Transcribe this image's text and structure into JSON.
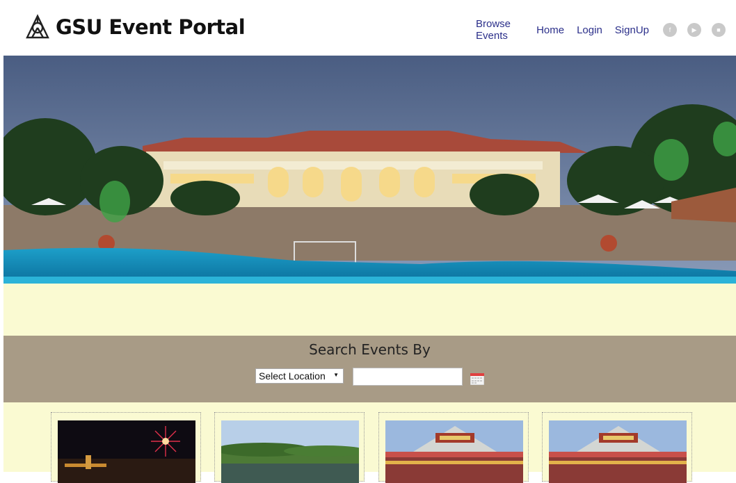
{
  "header": {
    "title": "GSU Event Portal",
    "nav": [
      "Browse Events",
      "Home",
      "Login",
      "SignUp"
    ],
    "social_icons": [
      "facebook-icon",
      "twitter-icon",
      "youtube-icon"
    ]
  },
  "search": {
    "title": "Search Events By",
    "location_value": "Select Location",
    "date_value": ""
  },
  "event_images": [
    "fireworks-night",
    "lake-trees",
    "tandoor-restaurant",
    "tandoor-restaurant"
  ],
  "colors": {
    "nav_link": "#2b2f8a",
    "band": "#fafad2",
    "search_bg": "#a89b86"
  }
}
